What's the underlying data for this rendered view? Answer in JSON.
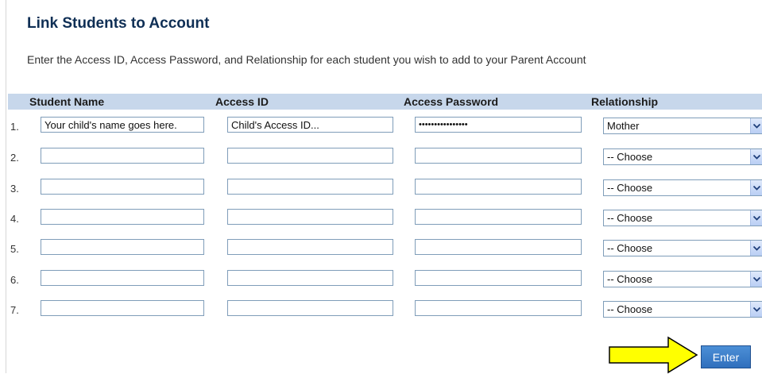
{
  "page": {
    "title": "Link Students to Account",
    "instructions": "Enter the Access ID, Access Password, and Relationship for each student you wish to add to your Parent Account"
  },
  "table": {
    "headers": [
      "Student Name",
      "Access ID",
      "Access Password",
      "Relationship"
    ],
    "rows": [
      {
        "num": "1.",
        "name": "Your child's name goes here.",
        "access_id": "Child's Access ID...",
        "password": "••••••••••••••••",
        "relationship": "Mother"
      },
      {
        "num": "2.",
        "name": "",
        "access_id": "",
        "password": "",
        "relationship": "-- Choose"
      },
      {
        "num": "3.",
        "name": "",
        "access_id": "",
        "password": "",
        "relationship": "-- Choose"
      },
      {
        "num": "4.",
        "name": "",
        "access_id": "",
        "password": "",
        "relationship": "-- Choose"
      },
      {
        "num": "5.",
        "name": "",
        "access_id": "",
        "password": "",
        "relationship": "-- Choose"
      },
      {
        "num": "6.",
        "name": "",
        "access_id": "",
        "password": "",
        "relationship": "-- Choose"
      },
      {
        "num": "7.",
        "name": "",
        "access_id": "",
        "password": "",
        "relationship": "-- Choose"
      }
    ]
  },
  "actions": {
    "enter_label": "Enter"
  },
  "colors": {
    "header_bar": "#c7d7eb",
    "title": "#0f2f55",
    "enter_button": "#3b7dc9",
    "arrow_fill": "#ffff00"
  },
  "icons": {
    "dropdown": "chevron-down-icon",
    "pointer": "right-arrow-icon"
  }
}
